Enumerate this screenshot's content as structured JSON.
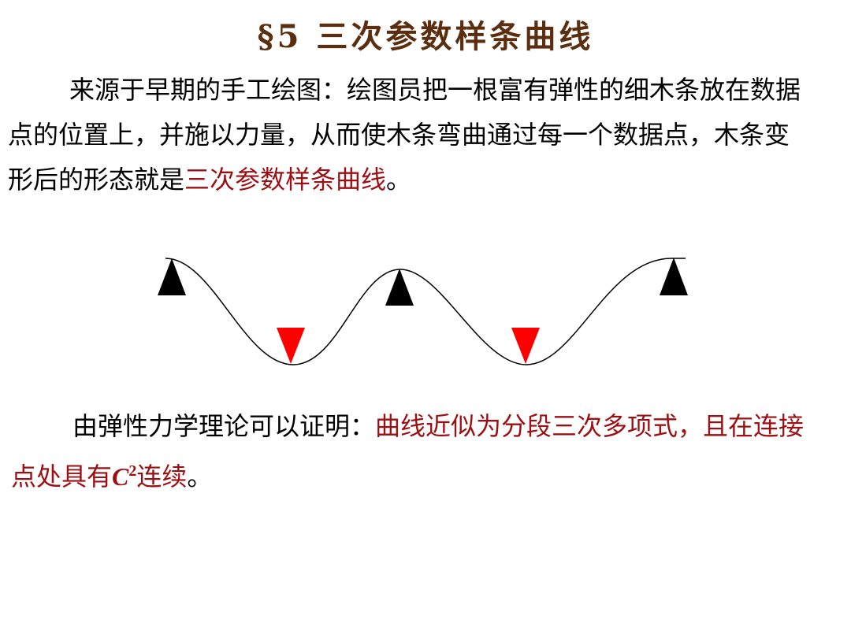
{
  "title": "§5 三次参数样条曲线",
  "colors": {
    "title": "#5a2e0e",
    "highlight": "#9c0f13",
    "support_up": "#000000",
    "support_down": "#ff0000"
  },
  "intro": {
    "text": "来源于早期的手工绘图：绘图员把一根富有弹性的细木条放在数据点的位置上，并施以力量，从而使木条弯曲通过每一个数据点，木条变形后的形态就是",
    "highlight": "三次参数样条曲线",
    "end": "。"
  },
  "theory": {
    "text": "由弹性力学理论可以证明：",
    "highlight_prefix": "曲线近似为分段三次多项式，且在连接点处具有",
    "c_letter": "C",
    "superscript": "2",
    "highlight_suffix": "连续",
    "end": "。"
  },
  "diagram": {
    "supports": [
      {
        "direction": "up",
        "color": "#000000"
      },
      {
        "direction": "down",
        "color": "#ff0000"
      },
      {
        "direction": "up",
        "color": "#000000"
      },
      {
        "direction": "down",
        "color": "#ff0000"
      },
      {
        "direction": "up",
        "color": "#000000"
      }
    ]
  }
}
